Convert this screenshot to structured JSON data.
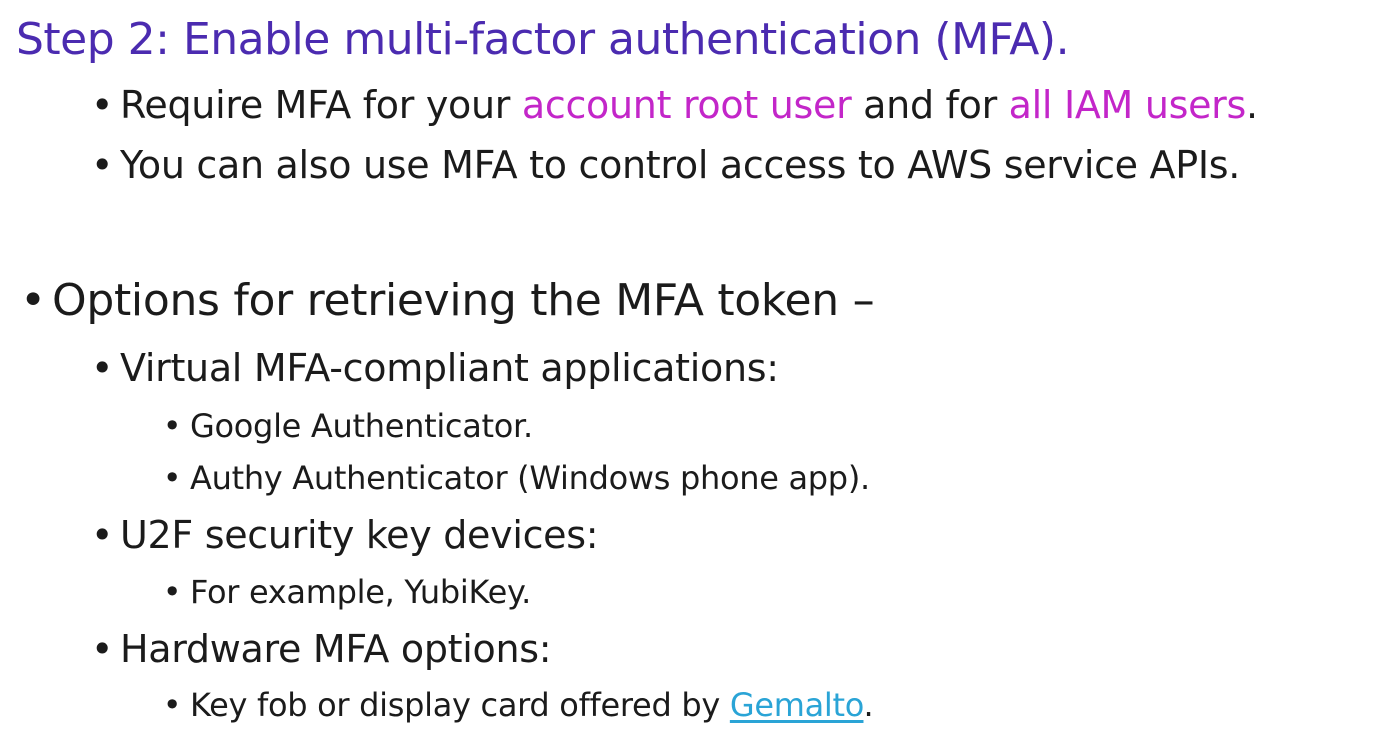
{
  "title": "Step 2: Enable multi-factor authentication (MFA).",
  "bullet_glyph": "•",
  "mfa_requirement": {
    "prefix": "Require MFA for your ",
    "highlight_1": "account root user",
    "middle": " and for ",
    "highlight_2": "all IAM users",
    "suffix": "."
  },
  "mfa_api_control": "You can also use MFA to control access to AWS service APIs.",
  "options_heading": "Options for retrieving the MFA token –",
  "virtual_apps": {
    "label": "Virtual MFA-compliant applications:",
    "items": [
      "Google Authenticator.",
      "Authy Authenticator (Windows phone app)."
    ]
  },
  "u2f": {
    "label": "U2F security key devices:",
    "items": [
      "For example, YubiKey."
    ]
  },
  "hardware": {
    "label": "Hardware MFA options:",
    "item_prefix": "Key fob or display card offered by ",
    "item_link": "Gemalto",
    "item_suffix": "."
  },
  "colors": {
    "title": "#4b2bb0",
    "highlight": "#c326c9",
    "link": "#2aa4d6",
    "text": "#1b1b1b"
  }
}
